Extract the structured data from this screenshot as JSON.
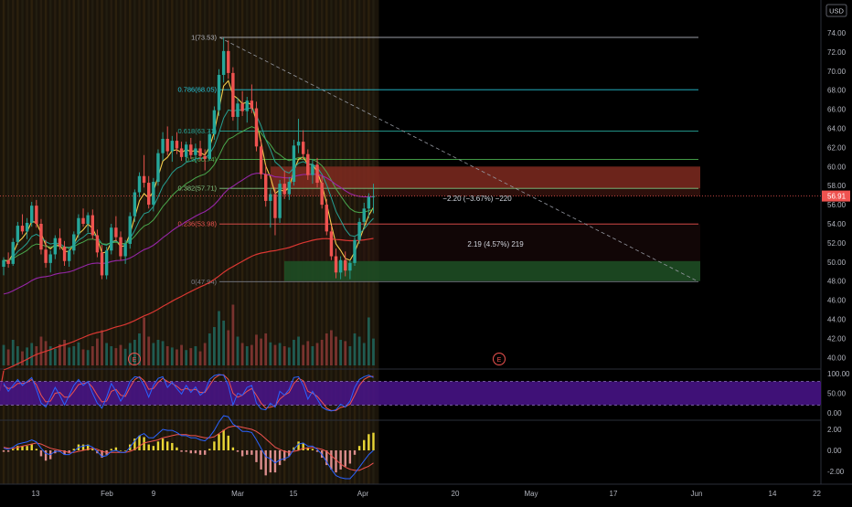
{
  "header": {
    "currency": "USD"
  },
  "colors": {
    "bg": "#000000",
    "up": "#26a69a",
    "down": "#ef5350",
    "fib_top": "#b2b5be",
    "fib_786": "#26c6da",
    "fib_618": "#26a69a",
    "fib_05": "#4caf50",
    "fib_382": "#81c784",
    "fib_236": "#ef5350",
    "fib_0": "#787b86",
    "ma_fast": "#ffd54f",
    "ma_mid": "#26a69a",
    "ma_slow": "#4caf50",
    "ma_long": "#9c27b0",
    "ma_200": "#e53935",
    "stoch_k": "#2962ff",
    "stoch_d": "#ef5350",
    "stoch_band": "#4a148c",
    "macd_line": "#2962ff",
    "macd_signal": "#ef5350",
    "hist_pos": "#ffeb3b",
    "hist_neg": "#ef9a9a",
    "short_zone": "#7f2a20",
    "long_zone": "#1e4d24"
  },
  "price_scale": {
    "ticks": [
      "74.00",
      "72.00",
      "70.00",
      "68.00",
      "66.00",
      "64.00",
      "62.00",
      "60.00",
      "58.00",
      "56.00",
      "54.00",
      "52.00",
      "50.00",
      "48.00",
      "46.00",
      "44.00",
      "42.00",
      "40.00"
    ],
    "current": "56.91"
  },
  "stoch_scale": {
    "ticks": [
      "100.00",
      "50.00",
      "0.00"
    ]
  },
  "macd_scale": {
    "ticks": [
      "2.00",
      "0.00",
      "-2.00"
    ]
  },
  "time_axis": {
    "labels": [
      "13",
      "Feb",
      "9",
      "Mar",
      "15",
      "Apr",
      "20",
      "May",
      "17",
      "Jun",
      "14",
      "22"
    ]
  },
  "fib_levels": [
    {
      "label": "1(73.53)",
      "value": 73.53
    },
    {
      "label": "0.786(68.05)",
      "value": 68.05
    },
    {
      "label": "0.618(63.71)",
      "value": 63.71
    },
    {
      "label": "0.5(60.74)",
      "value": 60.74
    },
    {
      "label": "0.382(57.71)",
      "value": 57.71
    },
    {
      "label": "0.236(53.98)",
      "value": 53.98
    },
    {
      "label": "0(47.94)",
      "value": 47.94
    }
  ],
  "annotations": {
    "short_position": "−2.20 (−3.67%) −220",
    "long_position": "2.19 (4.57%) 219",
    "earnings": [
      "E",
      "E"
    ]
  },
  "chart_data": {
    "type": "candlestick",
    "title": "",
    "xlabel": "",
    "ylabel": "",
    "ylim": [
      39,
      76
    ],
    "x_range": [
      "Jan 4",
      "Jun 22"
    ],
    "candles": [
      [
        49.5,
        50.5,
        48.6,
        50.2
      ],
      [
        50.2,
        51.0,
        49.4,
        49.8
      ],
      [
        49.8,
        52.5,
        49.6,
        52.1
      ],
      [
        52.1,
        54.2,
        51.8,
        53.8
      ],
      [
        53.8,
        55.0,
        52.9,
        53.2
      ],
      [
        53.2,
        54.6,
        52.4,
        54.1
      ],
      [
        54.1,
        56.3,
        53.7,
        55.9
      ],
      [
        55.9,
        56.5,
        53.6,
        54.0
      ],
      [
        54.0,
        54.5,
        50.8,
        51.3
      ],
      [
        51.3,
        52.3,
        49.4,
        49.9
      ],
      [
        49.9,
        51.2,
        48.9,
        50.8
      ],
      [
        50.8,
        52.8,
        50.3,
        52.5
      ],
      [
        52.5,
        53.5,
        51.3,
        51.6
      ],
      [
        51.6,
        52.2,
        49.6,
        50.1
      ],
      [
        50.1,
        51.5,
        49.5,
        51.2
      ],
      [
        51.2,
        53.2,
        50.8,
        52.9
      ],
      [
        52.9,
        55.0,
        52.5,
        54.6
      ],
      [
        54.6,
        55.6,
        53.7,
        54.0
      ],
      [
        54.0,
        55.2,
        53.1,
        54.9
      ],
      [
        54.9,
        55.5,
        52.4,
        52.8
      ],
      [
        52.8,
        53.4,
        50.5,
        51.0
      ],
      [
        51.0,
        51.8,
        48.2,
        48.6
      ],
      [
        48.6,
        51.6,
        48.2,
        51.2
      ],
      [
        51.2,
        54.0,
        50.8,
        53.6
      ],
      [
        53.6,
        54.8,
        52.2,
        52.6
      ],
      [
        52.6,
        53.2,
        50.2,
        50.6
      ],
      [
        50.6,
        52.3,
        49.8,
        51.9
      ],
      [
        51.9,
        55.2,
        51.4,
        54.8
      ],
      [
        54.8,
        57.6,
        54.2,
        57.3
      ],
      [
        57.3,
        59.4,
        56.8,
        59.0
      ],
      [
        59.0,
        61.2,
        57.8,
        58.3
      ],
      [
        58.3,
        59.0,
        55.6,
        56.0
      ],
      [
        56.0,
        58.8,
        55.3,
        58.4
      ],
      [
        58.4,
        61.8,
        58.0,
        61.4
      ],
      [
        61.4,
        63.6,
        60.6,
        62.9
      ],
      [
        62.9,
        64.2,
        61.2,
        61.6
      ],
      [
        61.6,
        63.2,
        60.5,
        62.7
      ],
      [
        62.7,
        63.6,
        61.3,
        61.9
      ],
      [
        61.9,
        62.6,
        60.6,
        61.0
      ],
      [
        61.0,
        62.6,
        60.5,
        62.3
      ],
      [
        62.3,
        63.0,
        60.8,
        61.2
      ],
      [
        61.2,
        62.4,
        60.4,
        61.9
      ],
      [
        61.9,
        62.7,
        60.6,
        61.1
      ],
      [
        61.1,
        61.8,
        59.6,
        60.8
      ],
      [
        60.8,
        63.8,
        60.6,
        63.4
      ],
      [
        63.4,
        66.3,
        62.8,
        65.9
      ],
      [
        65.9,
        70.2,
        65.3,
        69.6
      ],
      [
        69.6,
        73.5,
        68.8,
        72.1
      ],
      [
        72.1,
        73.2,
        69.2,
        69.8
      ],
      [
        69.8,
        70.4,
        64.8,
        65.2
      ],
      [
        65.2,
        67.2,
        63.8,
        66.6
      ],
      [
        66.6,
        67.9,
        65.3,
        65.8
      ],
      [
        65.8,
        67.3,
        64.6,
        66.9
      ],
      [
        66.9,
        68.6,
        65.6,
        66.1
      ],
      [
        66.1,
        66.8,
        61.6,
        62.1
      ],
      [
        62.1,
        62.8,
        58.7,
        59.2
      ],
      [
        59.2,
        60.2,
        55.8,
        56.4
      ],
      [
        56.4,
        57.6,
        53.6,
        57.1
      ],
      [
        57.1,
        57.8,
        52.8,
        54.6
      ],
      [
        54.6,
        58.6,
        54.1,
        58.2
      ],
      [
        58.2,
        59.6,
        56.6,
        57.1
      ],
      [
        57.1,
        58.9,
        56.5,
        58.4
      ],
      [
        58.4,
        62.8,
        58.0,
        62.2
      ],
      [
        62.2,
        65.0,
        61.4,
        62.6
      ],
      [
        62.6,
        63.8,
        60.8,
        61.3
      ],
      [
        61.3,
        61.8,
        58.6,
        59.1
      ],
      [
        59.1,
        60.8,
        58.2,
        60.2
      ],
      [
        60.2,
        60.9,
        57.8,
        58.3
      ],
      [
        58.3,
        59.0,
        55.6,
        56.0
      ],
      [
        56.0,
        56.6,
        52.8,
        53.2
      ],
      [
        53.2,
        53.8,
        50.2,
        50.6
      ],
      [
        50.6,
        51.4,
        48.3,
        48.9
      ],
      [
        48.9,
        50.6,
        48.2,
        50.2
      ],
      [
        50.2,
        51.1,
        48.5,
        49.1
      ],
      [
        49.1,
        50.2,
        48.2,
        49.9
      ],
      [
        49.9,
        52.6,
        49.6,
        52.3
      ],
      [
        52.3,
        54.6,
        51.9,
        54.2
      ],
      [
        54.2,
        56.2,
        53.6,
        55.6
      ],
      [
        55.6,
        57.2,
        54.6,
        56.8
      ],
      [
        56.8,
        58.2,
        55.1,
        56.91
      ]
    ],
    "volume": [
      0.32,
      0.25,
      0.4,
      0.3,
      0.22,
      0.28,
      0.35,
      0.3,
      0.45,
      0.38,
      0.3,
      0.26,
      0.33,
      0.4,
      0.28,
      0.3,
      0.36,
      0.25,
      0.24,
      0.3,
      0.42,
      0.55,
      0.35,
      0.3,
      0.27,
      0.32,
      0.26,
      0.35,
      0.4,
      0.5,
      0.75,
      0.45,
      0.35,
      0.4,
      0.38,
      0.3,
      0.28,
      0.25,
      0.32,
      0.24,
      0.27,
      0.3,
      0.22,
      0.35,
      0.5,
      0.6,
      0.85,
      0.7,
      0.55,
      0.95,
      0.45,
      0.35,
      0.3,
      0.32,
      0.48,
      0.42,
      0.5,
      0.36,
      0.32,
      0.35,
      0.3,
      0.28,
      0.4,
      0.45,
      0.32,
      0.38,
      0.3,
      0.35,
      0.4,
      0.5,
      0.55,
      0.45,
      0.4,
      0.38,
      0.3,
      0.5,
      0.45,
      0.35,
      0.75,
      0.42
    ],
    "stoch_k": [
      75,
      55,
      70,
      85,
      70,
      80,
      90,
      60,
      25,
      15,
      40,
      65,
      45,
      20,
      45,
      70,
      85,
      70,
      80,
      50,
      25,
      12,
      40,
      75,
      55,
      30,
      50,
      80,
      92,
      90,
      70,
      40,
      70,
      88,
      92,
      65,
      78,
      62,
      48,
      70,
      52,
      66,
      45,
      55,
      85,
      95,
      98,
      96,
      70,
      20,
      50,
      45,
      65,
      70,
      25,
      10,
      8,
      25,
      15,
      55,
      45,
      60,
      90,
      92,
      70,
      35,
      55,
      35,
      15,
      8,
      5,
      8,
      22,
      15,
      30,
      65,
      85,
      92,
      96,
      90
    ],
    "stoch_d": [
      70,
      62,
      65,
      75,
      75,
      78,
      85,
      72,
      45,
      28,
      30,
      50,
      52,
      40,
      40,
      55,
      72,
      75,
      78,
      65,
      45,
      28,
      30,
      55,
      60,
      45,
      42,
      65,
      85,
      92,
      82,
      60,
      62,
      78,
      88,
      80,
      75,
      68,
      58,
      62,
      58,
      60,
      52,
      52,
      70,
      88,
      96,
      97,
      85,
      50,
      40,
      45,
      55,
      62,
      45,
      25,
      12,
      15,
      18,
      35,
      45,
      52,
      75,
      88,
      82,
      55,
      50,
      42,
      28,
      12,
      6,
      6,
      14,
      16,
      22,
      45,
      70,
      85,
      92,
      93
    ],
    "macd": [
      0.2,
      0.1,
      0.3,
      0.6,
      0.7,
      0.8,
      1.0,
      0.8,
      0.2,
      -0.3,
      -0.4,
      -0.1,
      -0.1,
      -0.4,
      -0.4,
      -0.1,
      0.3,
      0.4,
      0.5,
      0.3,
      -0.1,
      -0.6,
      -0.5,
      -0.1,
      0.0,
      -0.2,
      -0.2,
      0.3,
      0.9,
      1.4,
      1.6,
      1.2,
      1.2,
      1.6,
      2.0,
      1.9,
      1.9,
      1.7,
      1.4,
      1.4,
      1.2,
      1.2,
      1.0,
      0.9,
      1.3,
      1.9,
      2.7,
      3.3,
      3.2,
      2.5,
      2.2,
      1.8,
      1.8,
      1.7,
      1.0,
      0.2,
      -0.6,
      -0.8,
      -1.2,
      -0.9,
      -0.8,
      -0.6,
      0.1,
      0.6,
      0.7,
      0.4,
      0.4,
      0.1,
      -0.4,
      -1.1,
      -1.8,
      -2.4,
      -2.6,
      -2.7,
      -2.7,
      -2.2,
      -1.6,
      -1.0,
      -0.4,
      0.0
    ],
    "macd_signal": [
      0.3,
      0.2,
      0.2,
      0.3,
      0.4,
      0.5,
      0.6,
      0.7,
      0.6,
      0.4,
      0.2,
      0.1,
      0.0,
      -0.1,
      -0.2,
      -0.2,
      -0.1,
      0.0,
      0.1,
      0.2,
      0.1,
      -0.1,
      -0.2,
      -0.2,
      -0.2,
      -0.2,
      -0.2,
      -0.1,
      0.1,
      0.4,
      0.7,
      0.8,
      0.9,
      1.0,
      1.2,
      1.3,
      1.4,
      1.5,
      1.5,
      1.5,
      1.4,
      1.4,
      1.3,
      1.2,
      1.2,
      1.3,
      1.6,
      1.9,
      2.2,
      2.3,
      2.3,
      2.2,
      2.1,
      2.0,
      1.8,
      1.5,
      1.1,
      0.7,
      0.3,
      0.1,
      -0.1,
      -0.2,
      -0.1,
      0.0,
      0.2,
      0.2,
      0.3,
      0.2,
      0.1,
      -0.1,
      -0.5,
      -0.9,
      -1.3,
      -1.6,
      -1.8,
      -1.9,
      -1.9,
      -1.7,
      -1.5,
      -1.2
    ]
  }
}
